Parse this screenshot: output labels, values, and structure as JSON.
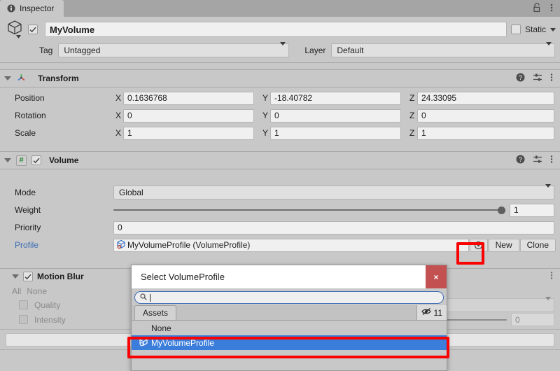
{
  "window": {
    "tab_label": "Inspector",
    "tab_icon": "info-icon",
    "lock_icon": "lock-open-icon",
    "menu_icon": "kebab-menu-icon"
  },
  "gameobject": {
    "prefab_icon": "cube-icon",
    "enabled": true,
    "name": "MyVolume",
    "static_label": "Static",
    "tag_label": "Tag",
    "tag_value": "Untagged",
    "layer_label": "Layer",
    "layer_value": "Default"
  },
  "transform": {
    "title": "Transform",
    "icon": "transform-axis-icon",
    "help_icon": "help-icon",
    "preset_icon": "preset-sliders-icon",
    "menu_icon": "kebab-menu-icon",
    "rows": [
      {
        "label": "Position",
        "x": "0.1636768",
        "y": "-18.40782",
        "z": "24.33095"
      },
      {
        "label": "Rotation",
        "x": "0",
        "y": "0",
        "z": "0"
      },
      {
        "label": "Scale",
        "x": "1",
        "y": "1",
        "z": "1"
      }
    ],
    "axes": [
      "X",
      "Y",
      "Z"
    ]
  },
  "volume": {
    "title": "Volume",
    "script_icon": "#",
    "enabled": true,
    "help_icon": "help-icon",
    "preset_icon": "preset-sliders-icon",
    "menu_icon": "kebab-menu-icon",
    "mode_label": "Mode",
    "mode_value": "Global",
    "weight_label": "Weight",
    "weight_value": "1",
    "weight_fraction": 1.0,
    "priority_label": "Priority",
    "priority_value": "0",
    "profile_label": "Profile",
    "profile_value": "MyVolumeProfile (VolumeProfile)",
    "profile_icon": "volume-profile-asset-icon",
    "picker_icon": "object-picker-target-icon",
    "new_button": "New",
    "clone_button": "Clone"
  },
  "motion_blur": {
    "title": "Motion Blur",
    "enabled": true,
    "all_label": "All",
    "none_label": "None",
    "rows": [
      {
        "label": "Quality"
      },
      {
        "label": "Intensity"
      }
    ],
    "hidden_dropdown_value": "",
    "hidden_number_value": "0"
  },
  "dialog": {
    "title": "Select VolumeProfile",
    "close_label": "×",
    "search_icon": "search-icon",
    "search_value": "",
    "search_placeholder": "",
    "tab_label": "Assets",
    "visibility_icon": "eye-crossed-icon",
    "count": "11",
    "items": [
      {
        "label": "None",
        "selected": false,
        "icon": ""
      },
      {
        "label": "MyVolumeProfile",
        "selected": true,
        "icon": "volume-profile-asset-icon"
      }
    ]
  },
  "annotations": {
    "color": "#fa0000",
    "boxes": [
      "object-picker-button",
      "selected-asset-row"
    ]
  }
}
